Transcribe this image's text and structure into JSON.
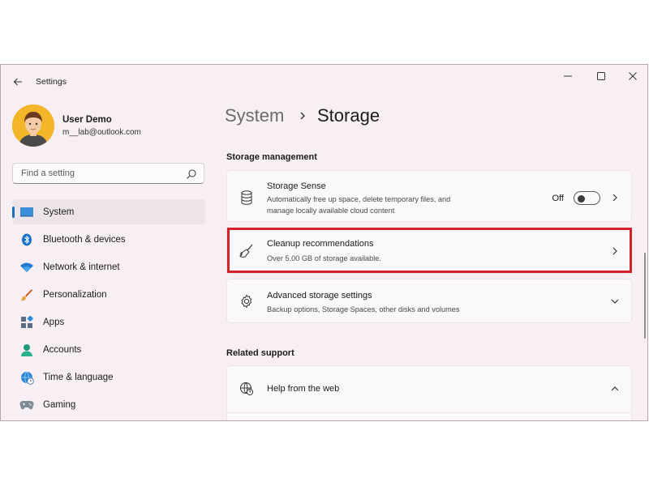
{
  "window": {
    "title": "Settings",
    "caption_icons": [
      "minimize-icon",
      "maximize-icon",
      "close-icon"
    ]
  },
  "profile": {
    "name": "User Demo",
    "email": "m__lab@outlook.com"
  },
  "search": {
    "placeholder": "Find a setting",
    "icon": "search-icon"
  },
  "sidebar": {
    "items": [
      {
        "label": "System",
        "icon": "system-monitor-icon",
        "selected": true
      },
      {
        "label": "Bluetooth & devices",
        "icon": "bluetooth-icon"
      },
      {
        "label": "Network & internet",
        "icon": "wifi-icon"
      },
      {
        "label": "Personalization",
        "icon": "brush-icon"
      },
      {
        "label": "Apps",
        "icon": "apps-icon"
      },
      {
        "label": "Accounts",
        "icon": "accounts-icon"
      },
      {
        "label": "Time & language",
        "icon": "globe-clock-icon"
      },
      {
        "label": "Gaming",
        "icon": "gamepad-icon"
      }
    ]
  },
  "breadcrumb": {
    "parent": "System",
    "current": "Storage"
  },
  "storage_management": {
    "heading": "Storage management",
    "storage_sense": {
      "title": "Storage Sense",
      "desc_line1": "Automatically free up space, delete temporary files, and",
      "desc_line2": "manage locally available cloud content",
      "toggle_label": "Off",
      "toggle_on": false
    },
    "cleanup": {
      "title": "Cleanup recommendations",
      "desc": "Over 5.00 GB of storage available.",
      "highlighted": true
    },
    "advanced": {
      "title": "Advanced storage settings",
      "desc": "Backup options, Storage Spaces, other disks and volumes"
    }
  },
  "related_support": {
    "heading": "Related support",
    "help": {
      "title": "Help from the web"
    }
  },
  "colors": {
    "accent": "#1a6ec4",
    "highlight": "#d3202a",
    "window_bg": "#f7eff3"
  }
}
